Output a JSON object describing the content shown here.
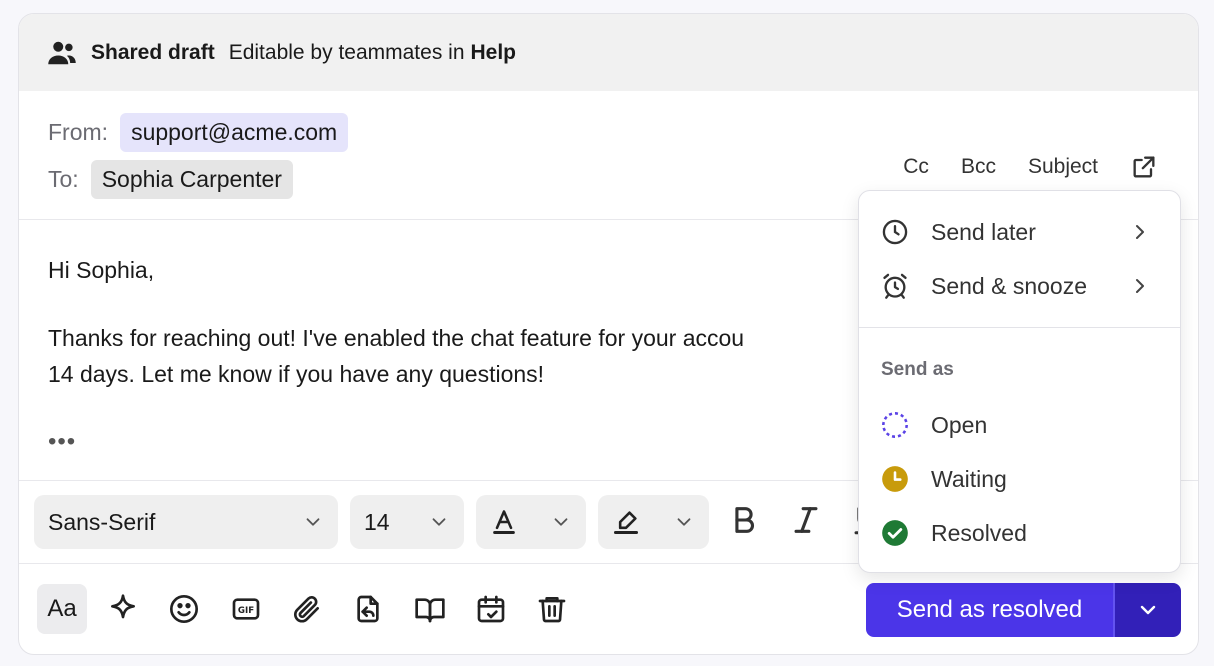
{
  "shared": {
    "icon": "users-icon",
    "title": "Shared draft",
    "description": "Editable by teammates in",
    "team": "Help"
  },
  "header": {
    "from_label": "From:",
    "from_value": "support@acme.com",
    "to_label": "To:",
    "to_value": "Sophia Carpenter",
    "cc": "Cc",
    "bcc": "Bcc",
    "subject": "Subject"
  },
  "body": {
    "greeting": "Hi Sophia,",
    "message": "Thanks for reaching out! I've enabled the chat feature for your accou\n14 days. Let me know if you have any questions!",
    "ellipsis": "•••"
  },
  "toolbar": {
    "font_family": "Sans-Serif",
    "font_size": "14"
  },
  "send": {
    "label": "Send as resolved",
    "primary_color": "#4b35e8"
  },
  "menu": {
    "send_later": "Send later",
    "send_snooze": "Send & snooze",
    "section": "Send as",
    "options": [
      {
        "label": "Open",
        "color": "#5b43e6"
      },
      {
        "label": "Waiting",
        "color": "#c89b0b"
      },
      {
        "label": "Resolved",
        "color": "#1f7a35"
      }
    ]
  }
}
